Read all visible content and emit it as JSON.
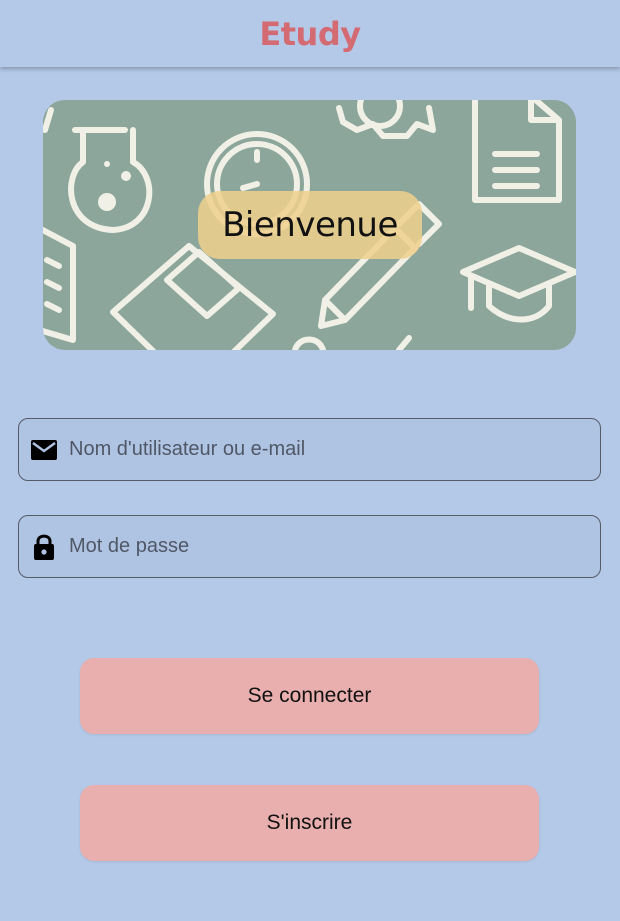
{
  "app": {
    "title": "Etudy",
    "accent": "#d46a72",
    "background": "#b4c8e8"
  },
  "banner": {
    "welcome_text": "Bienvenue"
  },
  "form": {
    "username": {
      "placeholder": "Nom d'utilisateur ou e-mail",
      "value": "",
      "icon": "mail-icon"
    },
    "password": {
      "placeholder": "Mot de passe",
      "value": "",
      "icon": "lock-icon"
    }
  },
  "actions": {
    "login_label": "Se connecter",
    "register_label": "S'inscrire",
    "button_color": "#e8afae"
  }
}
